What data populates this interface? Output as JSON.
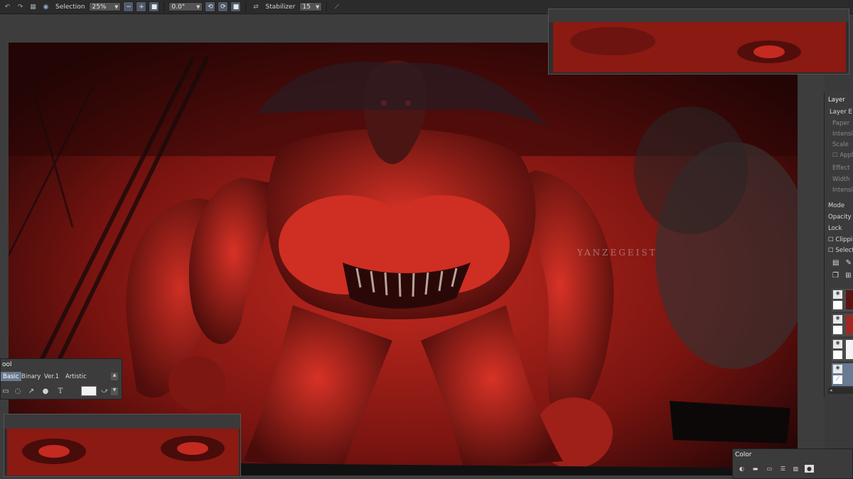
{
  "toolbar": {
    "selection_label": "Selection",
    "zoom_value": "25%",
    "rotation_value": "0.0°",
    "stabilizer_label": "Stabilizer",
    "stabilizer_value": "15",
    "icons": [
      "undo-icon",
      "redo-icon",
      "grid-icon",
      "eye-icon",
      "zoom-out-icon",
      "zoom-in-icon",
      "fit-icon",
      "rotate-left-icon",
      "rotate-right-icon",
      "reset-rotation-icon",
      "flip-icon",
      "pen-icon"
    ]
  },
  "artwork": {
    "signature": "YANZEGEIST"
  },
  "layer_panel": {
    "title": "Layer",
    "section": "Layer E",
    "paper": "Paper",
    "intensity1": "Intensit",
    "scale": "Scale",
    "apply": "Appl",
    "effect": "Effect",
    "width": "Width",
    "intensity2": "Intensit",
    "mode": "Mode",
    "opacity": "Opacity",
    "lock": "Lock",
    "clipping": "Clippin",
    "select": "Select"
  },
  "tool_panel": {
    "title": "ool",
    "tabs": [
      "Basic",
      "Binary",
      "Ver.1",
      "Artistic"
    ],
    "active_tab": "Basic"
  },
  "color_panel": {
    "title": "Color"
  },
  "colors": {
    "accent": "#6a7a93",
    "panel": "#3b3b3b",
    "art_red": "#b8231c"
  }
}
